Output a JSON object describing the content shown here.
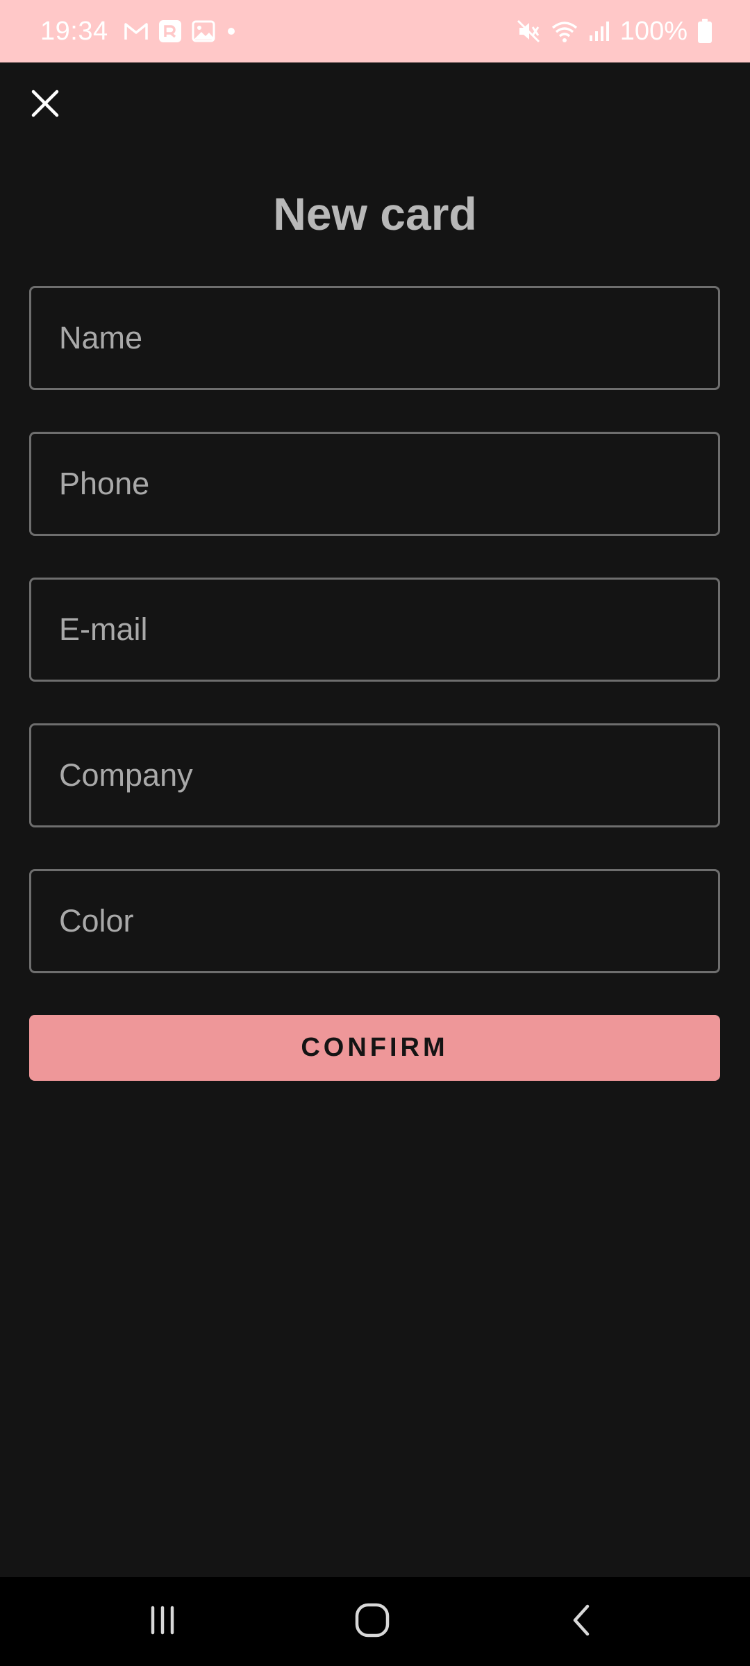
{
  "status_bar": {
    "time": "19:34",
    "battery": "100%",
    "background": "#ffc8c8",
    "icons": [
      "gmail-icon",
      "app-notification-icon",
      "gallery-icon",
      "dot-icon",
      "mute-icon",
      "wifi-icon",
      "signal-icon",
      "battery-icon"
    ]
  },
  "header": {
    "close_icon": "close-icon",
    "title": "New card"
  },
  "form": {
    "fields": [
      {
        "name": "name",
        "placeholder": "Name",
        "value": ""
      },
      {
        "name": "phone",
        "placeholder": "Phone",
        "value": ""
      },
      {
        "name": "email",
        "placeholder": "E-mail",
        "value": ""
      },
      {
        "name": "company",
        "placeholder": "Company",
        "value": ""
      },
      {
        "name": "color",
        "placeholder": "Color",
        "value": ""
      }
    ],
    "confirm_label": "CONFIRM",
    "accent_color": "#ee9799"
  },
  "nav_bar": {
    "icons": [
      "recent-apps-icon",
      "home-icon",
      "back-icon"
    ]
  },
  "colors": {
    "background": "#141414",
    "field_border": "#6e6e6e",
    "title": "#b8b8b8"
  }
}
